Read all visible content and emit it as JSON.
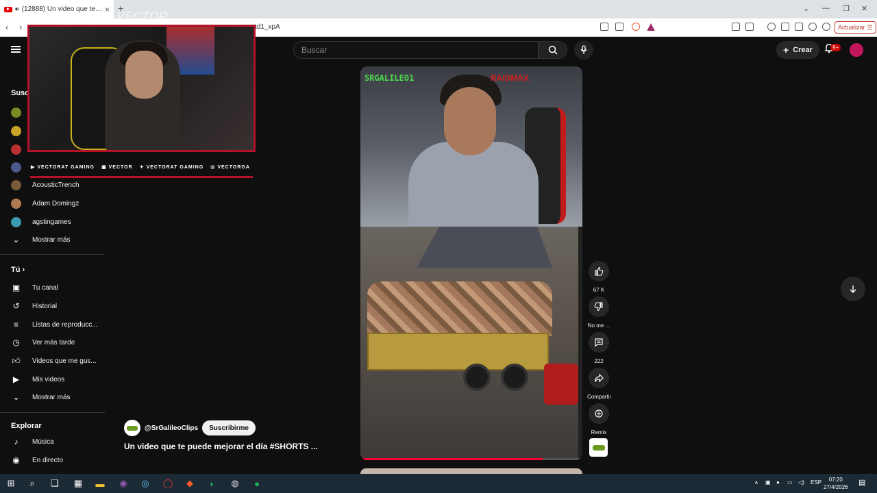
{
  "browser": {
    "tab_title": "(12888) Un video que te puede",
    "url": "td1_xpA",
    "update_button": "Actualizar"
  },
  "overlay": {
    "logo": "VECTOR",
    "social": [
      "VECTORAT GAMING",
      "VECTOR",
      "VECTORAT GAMING",
      "VECTORGA"
    ]
  },
  "youtube": {
    "search_placeholder": "Buscar",
    "create_label": "Crear",
    "notif_badge": "9+"
  },
  "sidebar": {
    "subs_head": "Susc",
    "channels": [
      {
        "label": "AcousticTrench",
        "color": "#7a5c3a"
      },
      {
        "label": "Adam Domingz",
        "color": "#b07a50"
      },
      {
        "label": "agstingames",
        "color": "#3a9ab0"
      }
    ],
    "show_more_1": "Mostrar más",
    "you_head": "Tú",
    "you_items": [
      "Tu canal",
      "Historial",
      "Listas de reproducc...",
      "Ver más tarde",
      "Videos que me gus...",
      "Mis videos",
      "Mostrar más"
    ],
    "explore_head": "Explorar",
    "explore_items": [
      "Música",
      "En directo"
    ]
  },
  "short": {
    "cam_tag": "SRGALILEO1",
    "cam_tag2": "RAIDMAX",
    "progress": 0.82,
    "actions": {
      "like_count": "67 K",
      "dislike_label": "No me ...",
      "comments_count": "222",
      "share_label": "Compartir",
      "remix_label": "Remix"
    }
  },
  "channel": {
    "handle": "@SrGalileoClips",
    "subscribe": "Suscribirme",
    "video_title": "Un video que te puede mejorar el día #SHORTS  ..."
  },
  "taskbar": {
    "lang": "ESP",
    "time": "07:20",
    "date": "27/4/2026"
  }
}
